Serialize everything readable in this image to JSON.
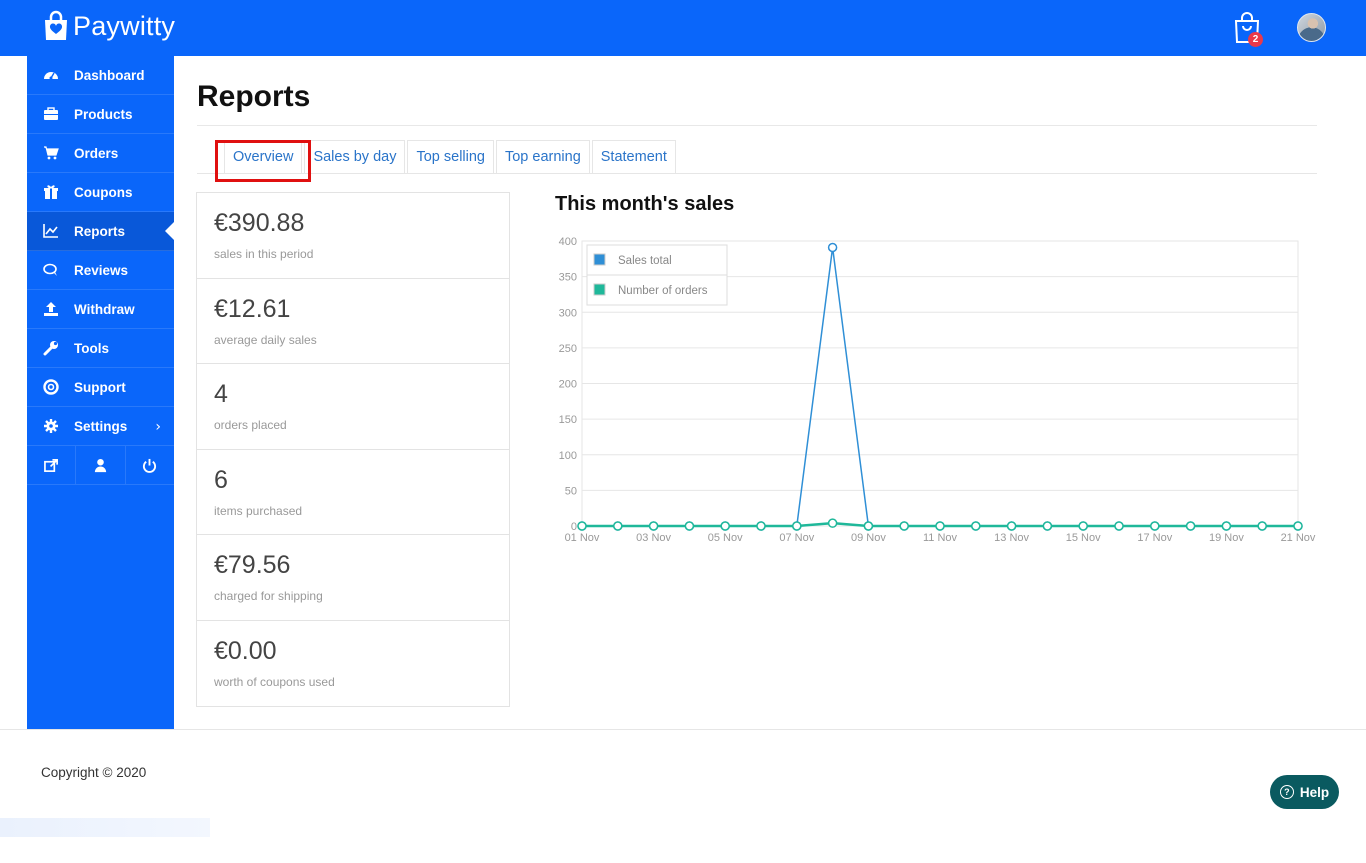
{
  "header": {
    "brand": "Paywitty",
    "cart_count": "2",
    "colors": {
      "primary": "#0a66fa",
      "badge": "#e9394a"
    }
  },
  "sidebar": {
    "items": [
      {
        "label": "Dashboard",
        "icon": "dashboard-icon"
      },
      {
        "label": "Products",
        "icon": "briefcase-icon"
      },
      {
        "label": "Orders",
        "icon": "cart-icon"
      },
      {
        "label": "Coupons",
        "icon": "gift-icon"
      },
      {
        "label": "Reports",
        "icon": "chart-line-icon",
        "active": true
      },
      {
        "label": "Reviews",
        "icon": "comments-icon"
      },
      {
        "label": "Withdraw",
        "icon": "upload-icon"
      },
      {
        "label": "Tools",
        "icon": "wrench-icon"
      },
      {
        "label": "Support",
        "icon": "life-ring-icon"
      },
      {
        "label": "Settings",
        "icon": "gear-icon",
        "has_submenu": true
      }
    ],
    "footer_icons": [
      "external-link-icon",
      "user-icon",
      "power-icon"
    ]
  },
  "page": {
    "title": "Reports",
    "tabs": [
      "Overview",
      "Sales by day",
      "Top selling",
      "Top earning",
      "Statement"
    ],
    "active_tab": "Overview"
  },
  "stats": [
    {
      "value": "€390.88",
      "label": "sales in this period"
    },
    {
      "value": "€12.61",
      "label": "average daily sales"
    },
    {
      "value": "4",
      "label": "orders placed"
    },
    {
      "value": "6",
      "label": "items purchased"
    },
    {
      "value": "€79.56",
      "label": "charged for shipping"
    },
    {
      "value": "€0.00",
      "label": "worth of coupons used"
    }
  ],
  "chart_title": "This month's sales",
  "chart_data": {
    "type": "line",
    "title": "This month's sales",
    "x": [
      "01 Nov",
      "02 Nov",
      "03 Nov",
      "04 Nov",
      "05 Nov",
      "06 Nov",
      "07 Nov",
      "08 Nov",
      "09 Nov",
      "10 Nov",
      "11 Nov",
      "12 Nov",
      "13 Nov",
      "14 Nov",
      "15 Nov",
      "16 Nov",
      "17 Nov",
      "18 Nov",
      "19 Nov",
      "20 Nov",
      "21 Nov"
    ],
    "x_tick_labels": [
      "01 Nov",
      "03 Nov",
      "05 Nov",
      "07 Nov",
      "09 Nov",
      "11 Nov",
      "13 Nov",
      "15 Nov",
      "17 Nov",
      "19 Nov",
      "21 Nov"
    ],
    "series": [
      {
        "name": "Sales total",
        "color": "#2f8fd6",
        "values": [
          0,
          0,
          0,
          0,
          0,
          0,
          0,
          390.88,
          0,
          0,
          0,
          0,
          0,
          0,
          0,
          0,
          0,
          0,
          0,
          0,
          0
        ]
      },
      {
        "name": "Number of orders",
        "color": "#1fb89a",
        "values": [
          0,
          0,
          0,
          0,
          0,
          0,
          0,
          4,
          0,
          0,
          0,
          0,
          0,
          0,
          0,
          0,
          0,
          0,
          0,
          0,
          0
        ]
      }
    ],
    "ylim": [
      0,
      400
    ],
    "y_ticks": [
      0,
      50,
      100,
      150,
      200,
      250,
      300,
      350,
      400
    ],
    "grid": true,
    "legend_position": "top-left"
  },
  "footer": {
    "copyright": "Copyright © 2020",
    "help_label": "Help"
  }
}
